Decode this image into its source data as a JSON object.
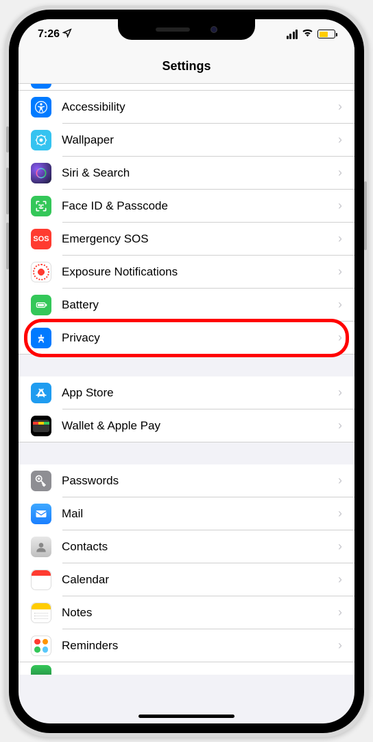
{
  "statusBar": {
    "time": "7:26"
  },
  "header": {
    "title": "Settings"
  },
  "sections": [
    {
      "items": [
        {
          "id": "accessibility",
          "label": "Accessibility"
        },
        {
          "id": "wallpaper",
          "label": "Wallpaper"
        },
        {
          "id": "siri",
          "label": "Siri & Search"
        },
        {
          "id": "faceid",
          "label": "Face ID & Passcode"
        },
        {
          "id": "sos",
          "label": "Emergency SOS",
          "iconText": "SOS"
        },
        {
          "id": "exposure",
          "label": "Exposure Notifications"
        },
        {
          "id": "battery",
          "label": "Battery"
        },
        {
          "id": "privacy",
          "label": "Privacy",
          "highlighted": true
        }
      ]
    },
    {
      "items": [
        {
          "id": "appstore",
          "label": "App Store"
        },
        {
          "id": "wallet",
          "label": "Wallet & Apple Pay"
        }
      ]
    },
    {
      "items": [
        {
          "id": "passwords",
          "label": "Passwords"
        },
        {
          "id": "mail",
          "label": "Mail"
        },
        {
          "id": "contacts",
          "label": "Contacts"
        },
        {
          "id": "calendar",
          "label": "Calendar"
        },
        {
          "id": "notes",
          "label": "Notes"
        },
        {
          "id": "reminders",
          "label": "Reminders"
        }
      ]
    }
  ]
}
